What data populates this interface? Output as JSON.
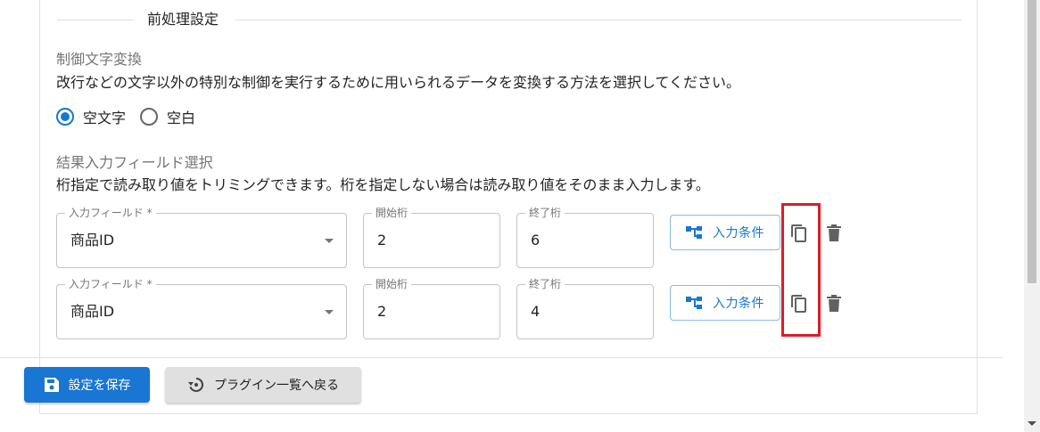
{
  "section": {
    "title": "前処理設定"
  },
  "control_char": {
    "label": "制御文字変換",
    "description": "改行などの文字以外の特別な制御を実行するために用いられるデータを変換する方法を選択してください。",
    "options": [
      {
        "label": "空文字",
        "selected": true
      },
      {
        "label": "空白",
        "selected": false
      }
    ]
  },
  "result_field": {
    "label": "結果入力フィールド選択",
    "description": "桁指定で読み取り値をトリミングできます。桁を指定しない場合は読み取り値をそのまま入力します。",
    "rows": [
      {
        "field_label": "入力フィールド *",
        "field_value": "商品ID",
        "start_label": "開始桁",
        "start_value": "2",
        "end_label": "終了桁",
        "end_value": "6",
        "condition_button": "入力条件",
        "copy_icon": "copy-icon",
        "delete_icon": "trash-icon"
      },
      {
        "field_label": "入力フィールド *",
        "field_value": "商品ID",
        "start_label": "開始桁",
        "start_value": "2",
        "end_label": "終了桁",
        "end_value": "4",
        "condition_button": "入力条件",
        "copy_icon": "copy-icon",
        "delete_icon": "trash-icon"
      }
    ]
  },
  "footer": {
    "save_label": "設定を保存",
    "back_label": "プラグイン一覧へ戻る"
  },
  "colors": {
    "primary": "#1976d2",
    "highlight": "#e01b24"
  }
}
